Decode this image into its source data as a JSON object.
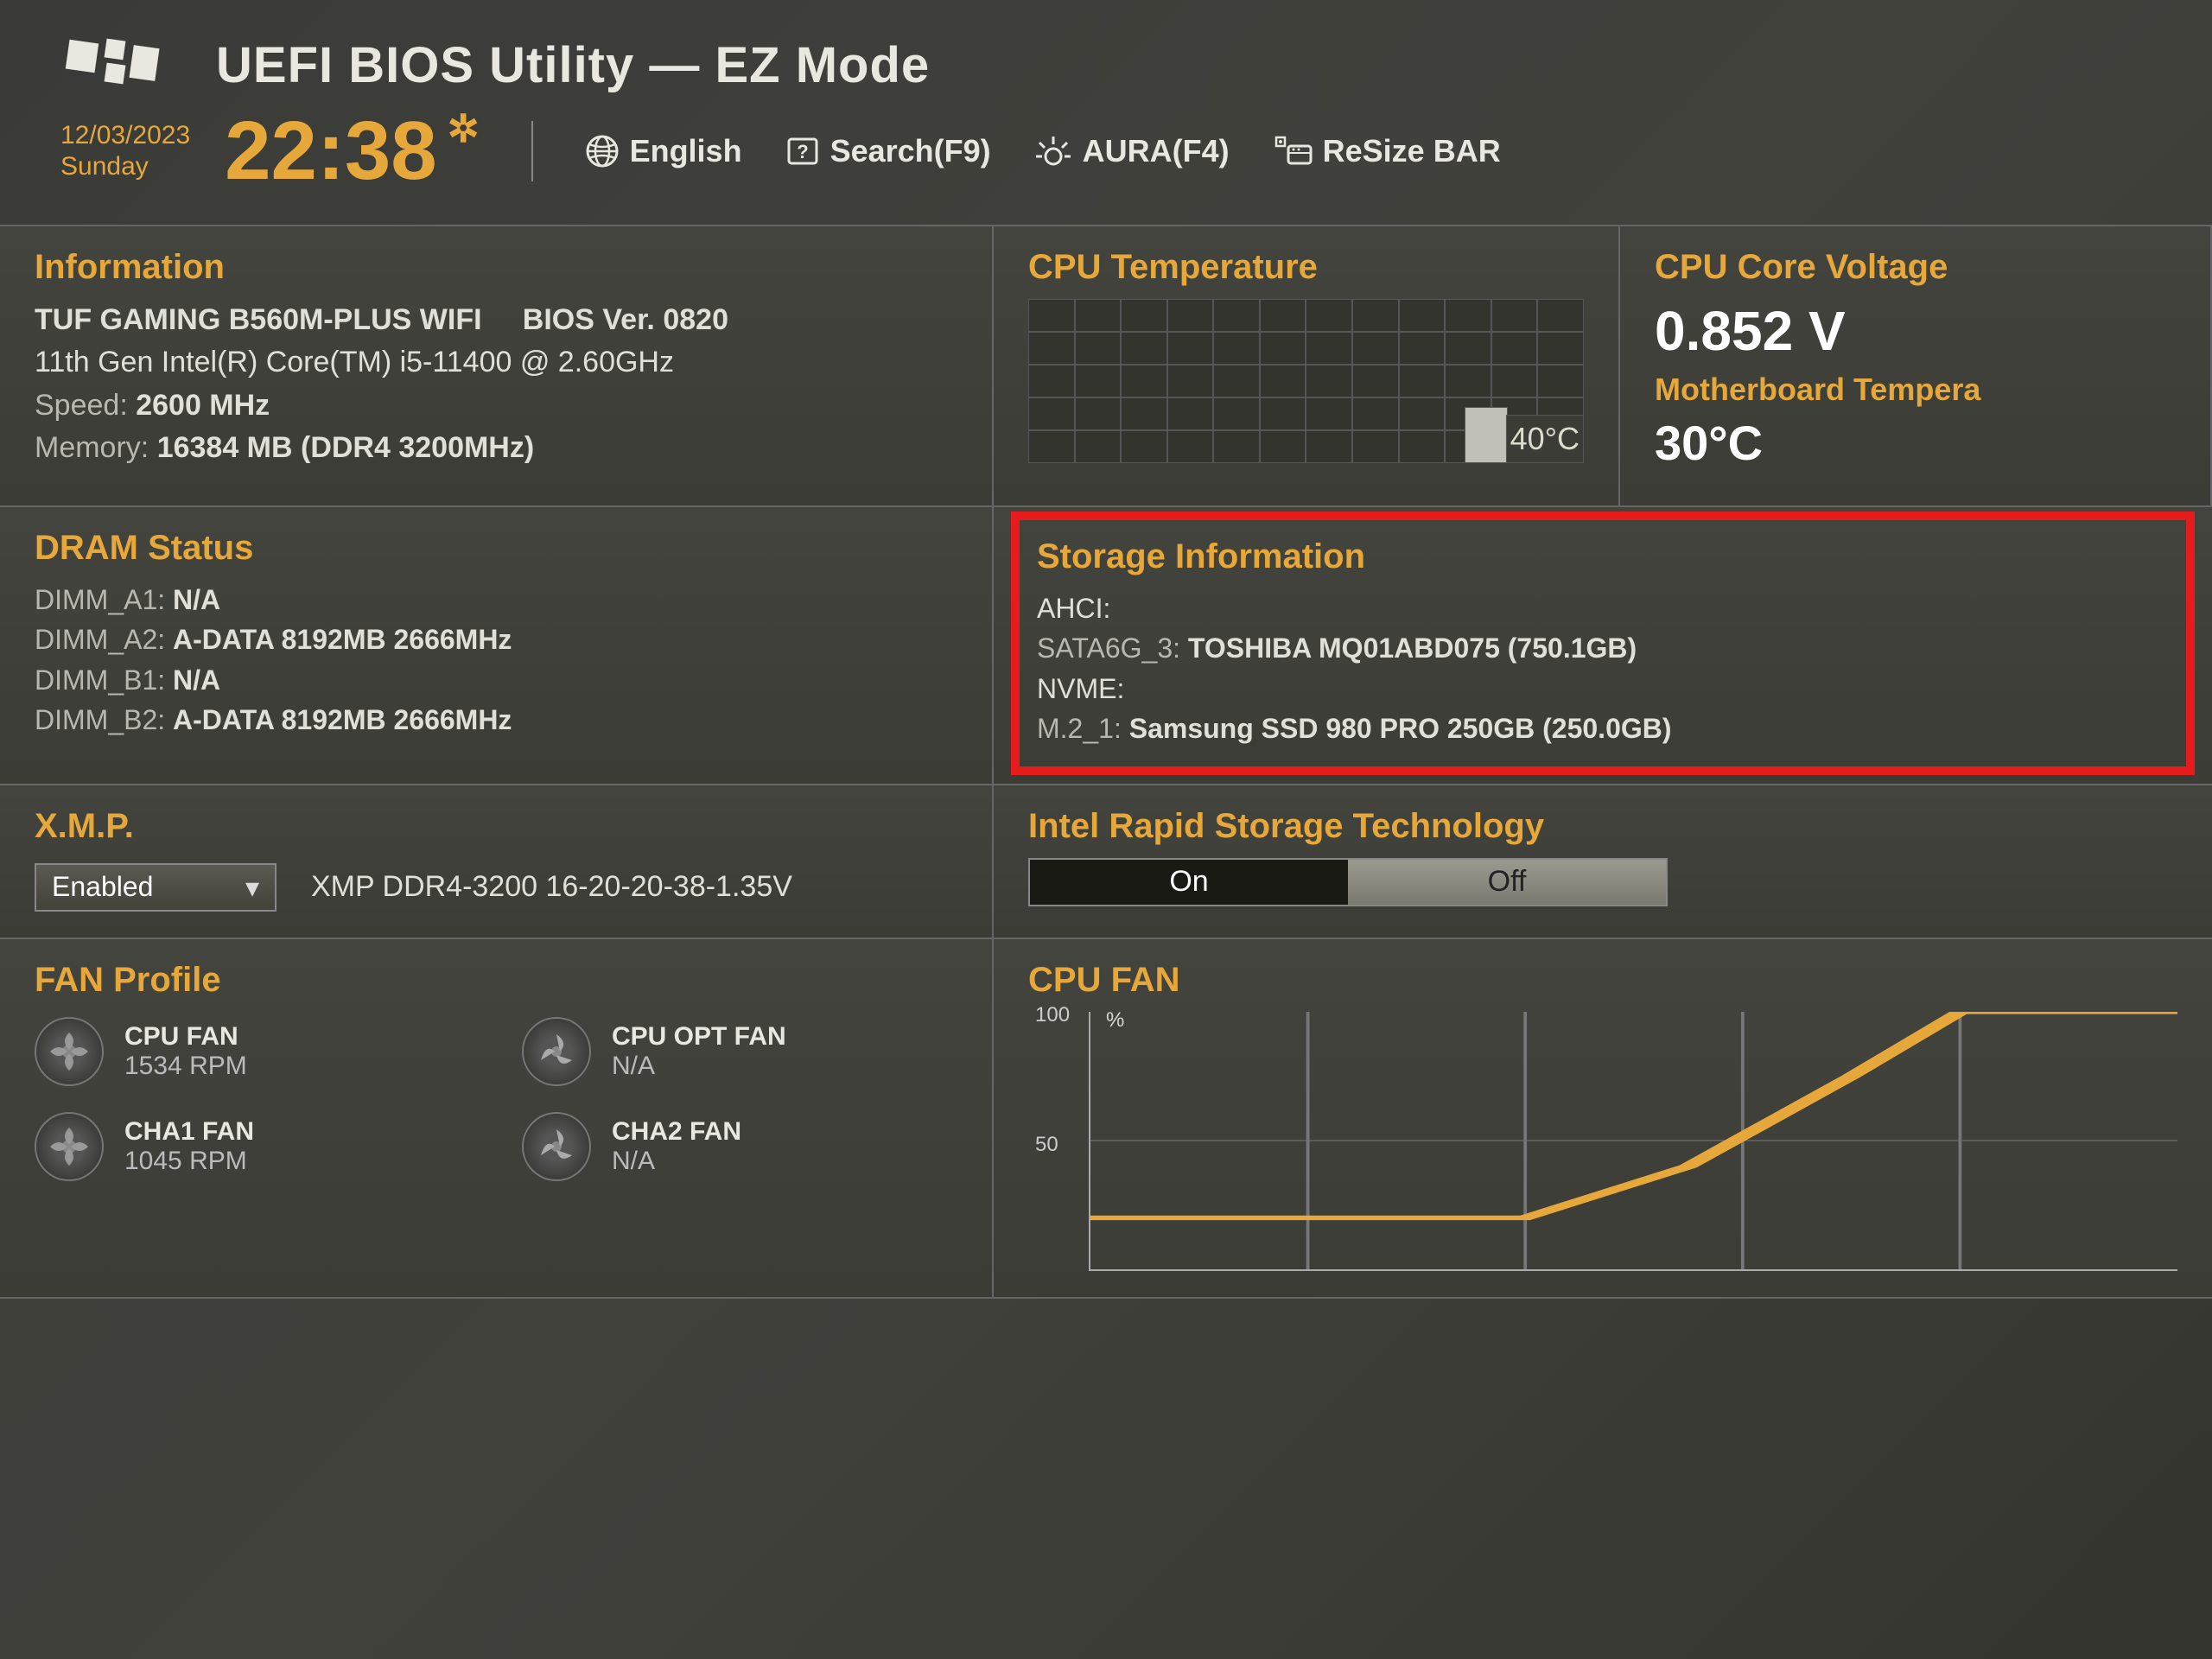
{
  "header": {
    "title": "UEFI BIOS Utility — EZ Mode"
  },
  "datetime": {
    "date": "12/03/2023",
    "day": "Sunday",
    "time": "22:38"
  },
  "topnav": {
    "language": "English",
    "search": "Search(F9)",
    "aura": "AURA(F4)",
    "resizebar": "ReSize BAR"
  },
  "information": {
    "title": "Information",
    "board": "TUF GAMING B560M-PLUS WIFI",
    "bios_ver_label": "BIOS Ver.",
    "bios_ver": "0820",
    "cpu": "11th Gen Intel(R) Core(TM) i5-11400 @ 2.60GHz",
    "speed_label": "Speed:",
    "speed": "2600 MHz",
    "memory_label": "Memory:",
    "memory": "16384 MB (DDR4 3200MHz)"
  },
  "cpu_temp": {
    "title": "CPU Temperature",
    "value": "40°C"
  },
  "voltage": {
    "title": "CPU Core Voltage",
    "value": "0.852 V",
    "mb_temp_title": "Motherboard Tempera",
    "mb_temp_value": "30°C"
  },
  "dram": {
    "title": "DRAM Status",
    "slots": [
      {
        "label": "DIMM_A1:",
        "value": "N/A"
      },
      {
        "label": "DIMM_A2:",
        "value": "A-DATA 8192MB 2666MHz"
      },
      {
        "label": "DIMM_B1:",
        "value": "N/A"
      },
      {
        "label": "DIMM_B2:",
        "value": "A-DATA 8192MB 2666MHz"
      }
    ]
  },
  "storage": {
    "title": "Storage Information",
    "ahci_label": "AHCI:",
    "ahci_port": "SATA6G_3:",
    "ahci_device": "TOSHIBA MQ01ABD075 (750.1GB)",
    "nvme_label": "NVME:",
    "nvme_port": "M.2_1:",
    "nvme_device": "Samsung SSD 980 PRO 250GB (250.0GB)"
  },
  "xmp": {
    "title": "X.M.P.",
    "selected": "Enabled",
    "profile": "XMP DDR4-3200 16-20-20-38-1.35V"
  },
  "irst": {
    "title": "Intel Rapid Storage Technology",
    "on": "On",
    "off": "Off"
  },
  "fan_profile": {
    "title": "FAN Profile",
    "fans": [
      {
        "name": "CPU FAN",
        "rpm": "1534 RPM"
      },
      {
        "name": "CPU OPT FAN",
        "rpm": "N/A"
      },
      {
        "name": "CHA1 FAN",
        "rpm": "1045 RPM"
      },
      {
        "name": "CHA2 FAN",
        "rpm": "N/A"
      }
    ]
  },
  "cpu_fan_chart": {
    "title": "CPU FAN",
    "unit": "%",
    "y100": "100",
    "y50": "50"
  },
  "chart_data": {
    "type": "line",
    "title": "CPU FAN",
    "ylabel": "%",
    "ylim": [
      0,
      100
    ],
    "x": [
      0,
      20,
      40,
      55,
      70,
      80,
      100
    ],
    "values": [
      20,
      20,
      20,
      40,
      75,
      100,
      100
    ]
  }
}
